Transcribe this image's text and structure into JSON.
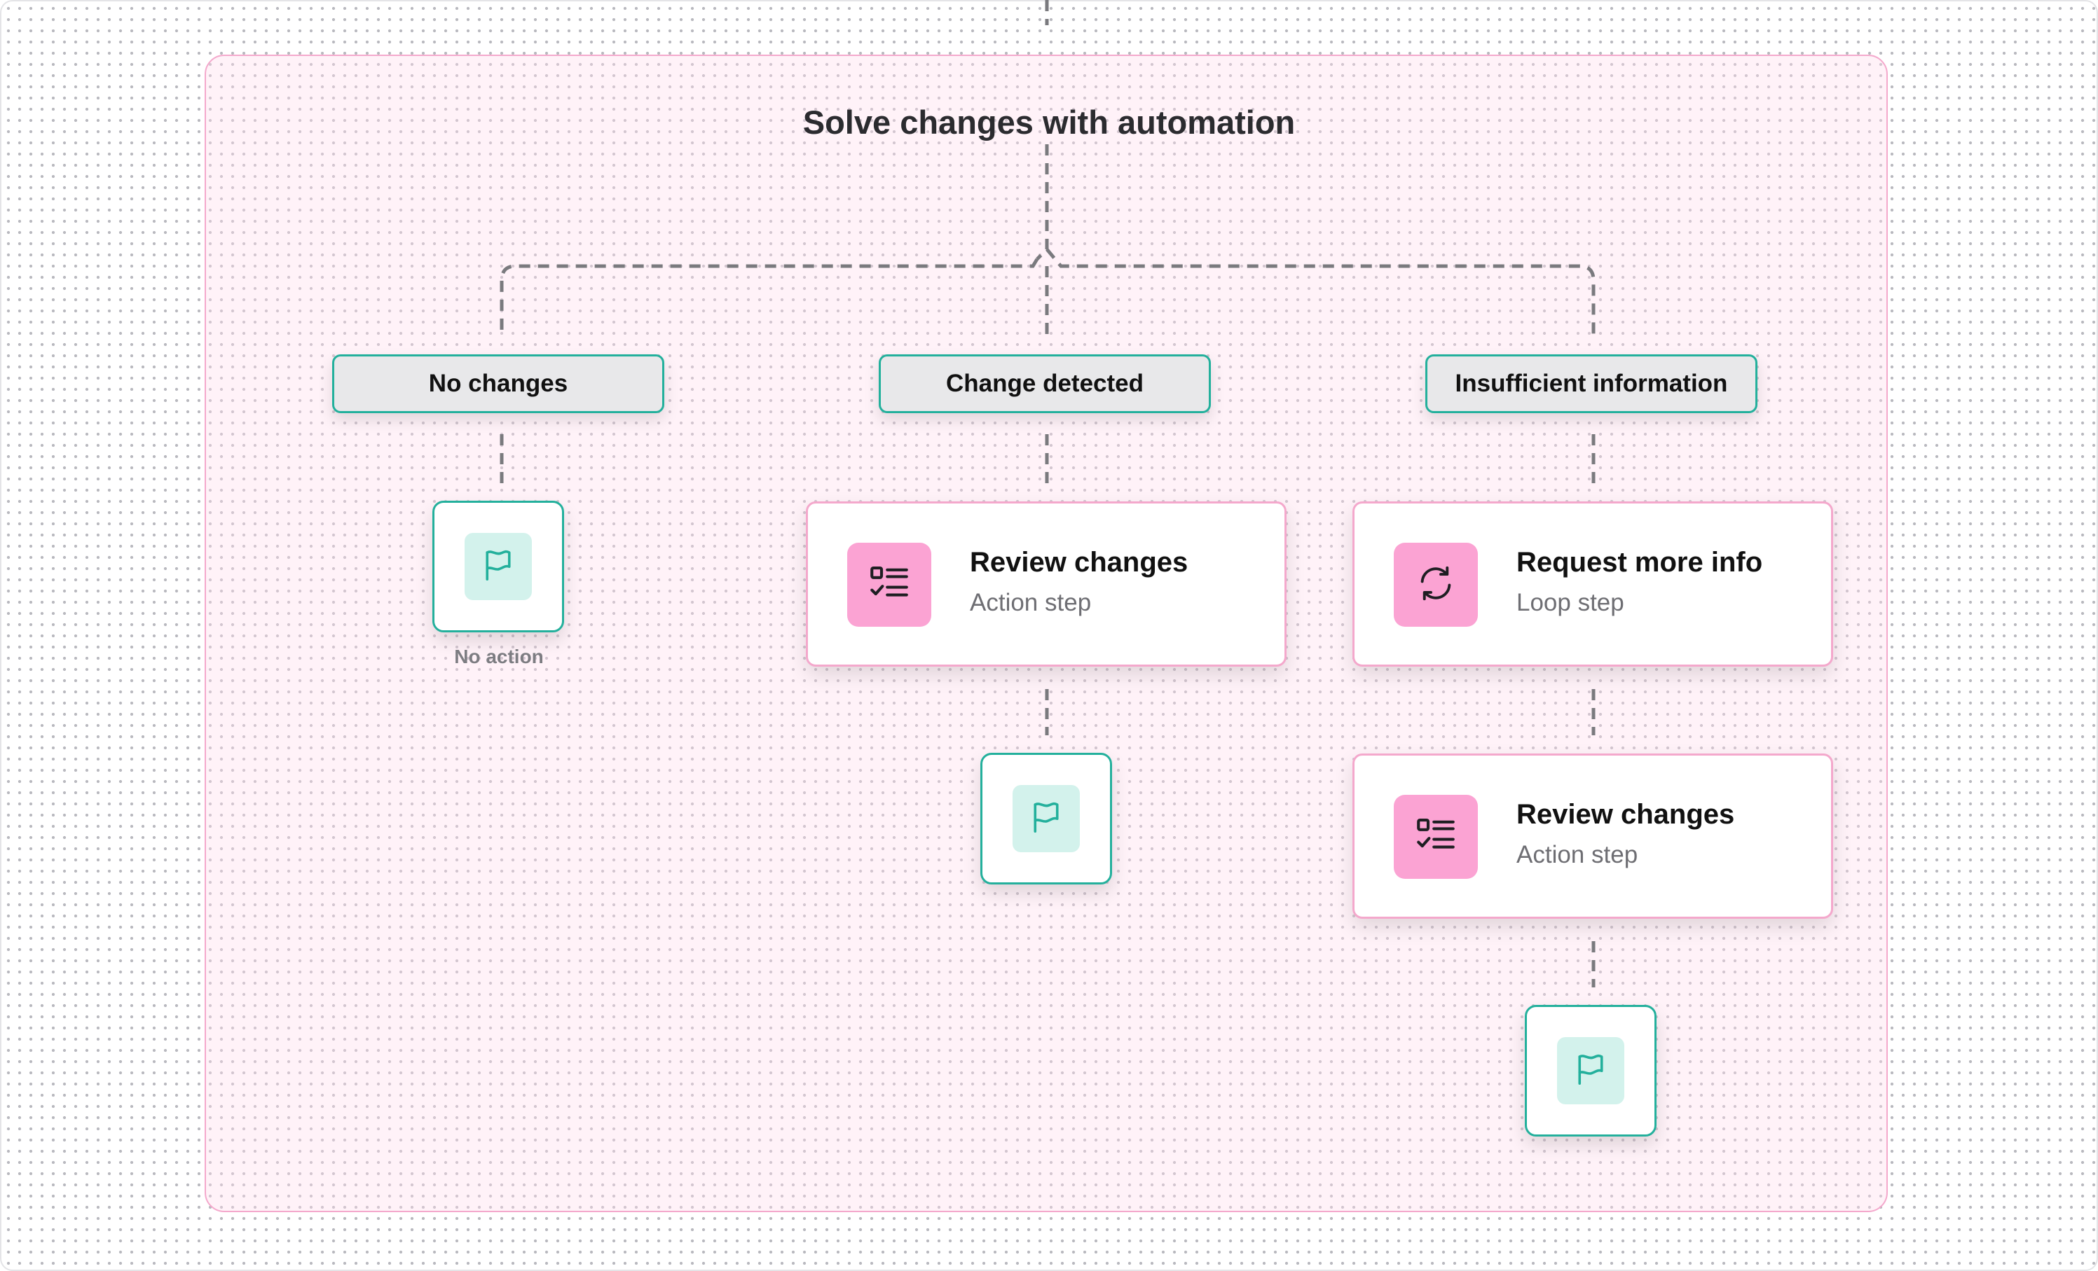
{
  "title": "Solve changes with automation",
  "branches": [
    {
      "label": "No changes"
    },
    {
      "label": "Change detected"
    },
    {
      "label": "Insufficient information"
    }
  ],
  "no_action_caption": "No action",
  "steps": {
    "review_1": {
      "title": "Review changes",
      "subtitle": "Action step",
      "icon": "checklist-icon"
    },
    "request_info": {
      "title": "Request more info",
      "subtitle": "Loop step",
      "icon": "refresh-icon"
    },
    "review_2": {
      "title": "Review changes",
      "subtitle": "Action step",
      "icon": "checklist-icon"
    }
  },
  "end_icon": "flag-icon",
  "colors": {
    "teal_border": "#23b09c",
    "pink_border": "#f4a8cc",
    "pink_icon_bg": "#fba3d3",
    "flag_tile_bg": "#d3f2ec",
    "container_bg": "#fff3f8",
    "connector": "#7a7a7e"
  }
}
